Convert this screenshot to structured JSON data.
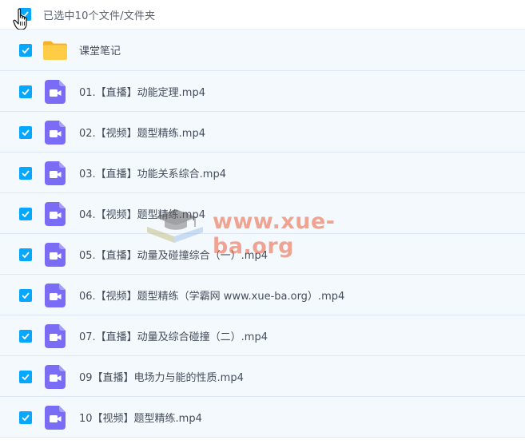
{
  "header": {
    "selection_text": "已选中10个文件/文件夹"
  },
  "items": [
    {
      "type": "folder",
      "name": "课堂笔记"
    },
    {
      "type": "video",
      "name": "01.【直播】动能定理.mp4"
    },
    {
      "type": "video",
      "name": "02.【视频】题型精练.mp4"
    },
    {
      "type": "video",
      "name": "03.【直播】功能关系综合.mp4"
    },
    {
      "type": "video",
      "name": "04.【视频】题型精练.mp4"
    },
    {
      "type": "video",
      "name": "05.【直播】动量及碰撞综合（一）.mp4"
    },
    {
      "type": "video",
      "name": "06.【视频】题型精练（学霸网 www.xue-ba.org）.mp4"
    },
    {
      "type": "video",
      "name": "07.【直播】动量及综合碰撞（二）.mp4"
    },
    {
      "type": "video",
      "name": "09【直播】电场力与能的性质.mp4"
    },
    {
      "type": "video",
      "name": "10【视频】题型精练.mp4"
    }
  ],
  "watermark": {
    "text": "www.xue-ba.org"
  },
  "colors": {
    "checkbox": "#06a7ff",
    "video_icon": "#7b6cf6",
    "folder": "#ffc93a",
    "row_bg": "#f4f9fe",
    "watermark": "#ec5c36"
  }
}
